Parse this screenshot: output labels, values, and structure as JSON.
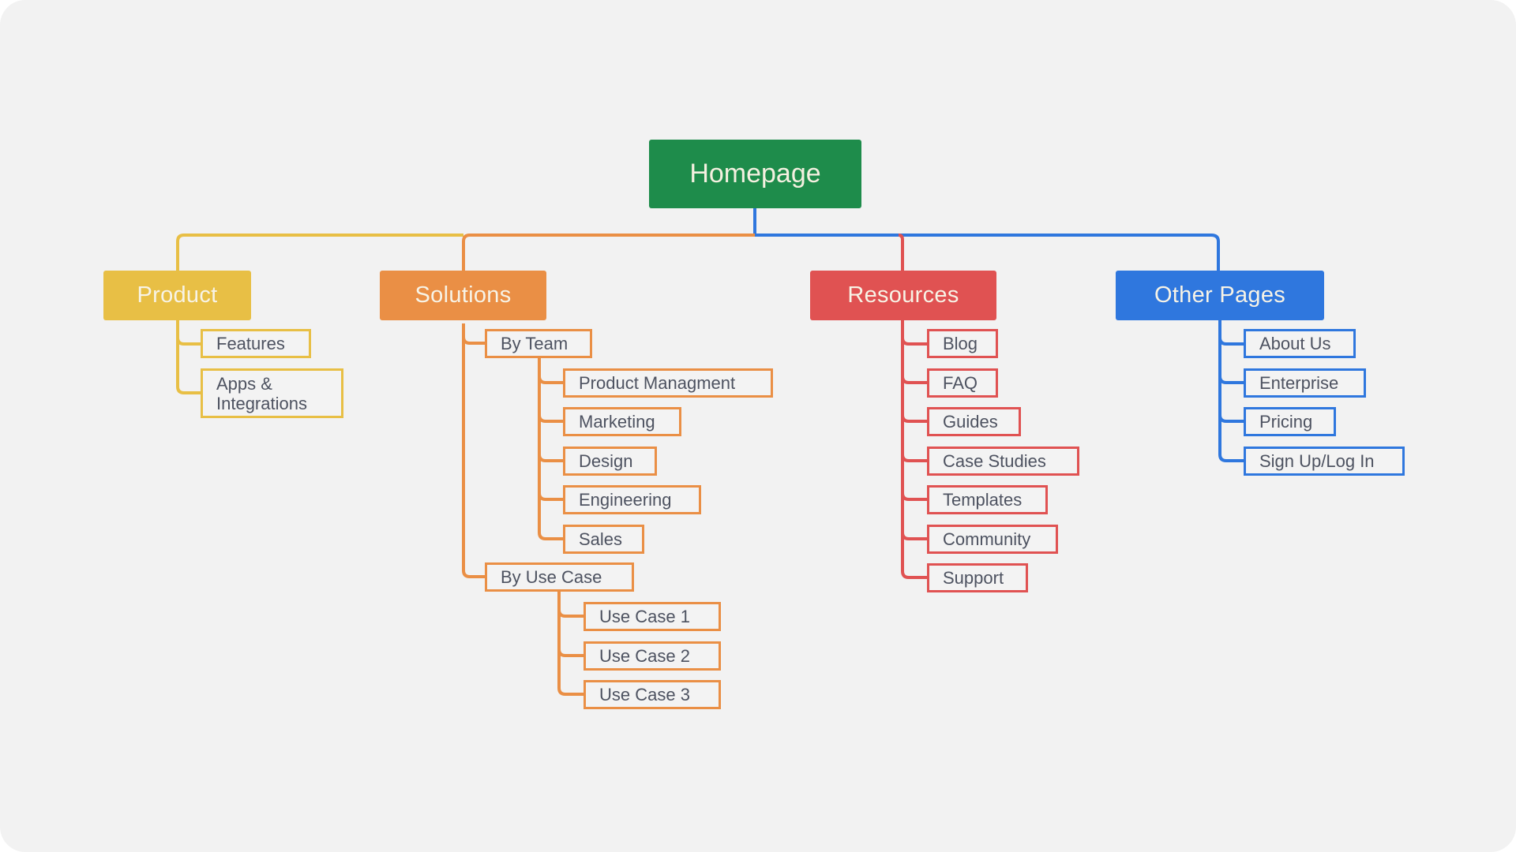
{
  "colors": {
    "background": "#f2f2f2",
    "root": "#1e8c4b",
    "product": "#e8bf45",
    "solutions": "#ea8f45",
    "resources": "#e05252",
    "other_pages": "#2f77de",
    "leaf_text": "#4d5260"
  },
  "root": {
    "label": "Homepage"
  },
  "categories": [
    {
      "key": "product",
      "label": "Product",
      "children": [
        {
          "label": "Features"
        },
        {
          "label": "Apps & Integrations"
        }
      ]
    },
    {
      "key": "solutions",
      "label": "Solutions",
      "children": [
        {
          "label": "By Team",
          "children": [
            {
              "label": "Product Managment"
            },
            {
              "label": "Marketing"
            },
            {
              "label": "Design"
            },
            {
              "label": "Engineering"
            },
            {
              "label": "Sales"
            }
          ]
        },
        {
          "label": "By Use Case",
          "children": [
            {
              "label": "Use Case 1"
            },
            {
              "label": "Use Case 2"
            },
            {
              "label": "Use Case 3"
            }
          ]
        }
      ]
    },
    {
      "key": "resources",
      "label": "Resources",
      "children": [
        {
          "label": "Blog"
        },
        {
          "label": "FAQ"
        },
        {
          "label": "Guides"
        },
        {
          "label": "Case Studies"
        },
        {
          "label": "Templates"
        },
        {
          "label": "Community"
        },
        {
          "label": "Support"
        }
      ]
    },
    {
      "key": "other_pages",
      "label": "Other Pages",
      "children": [
        {
          "label": "About Us"
        },
        {
          "label": "Enterprise"
        },
        {
          "label": "Pricing"
        },
        {
          "label": "Sign Up/Log In"
        }
      ]
    }
  ]
}
